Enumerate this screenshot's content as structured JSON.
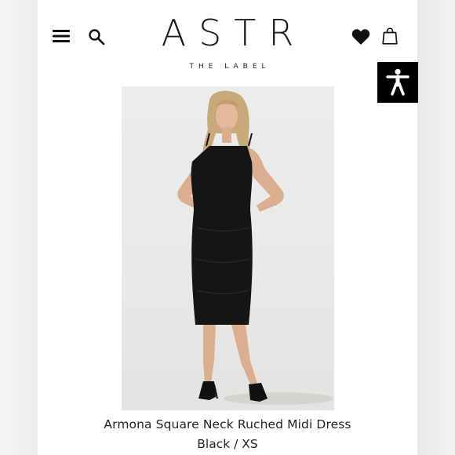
{
  "header": {
    "logo_main": "ASTR",
    "logo_sub": "THE LABEL",
    "icons": {
      "menu": "hamburger-menu-icon",
      "search": "search-icon",
      "wishlist": "heart-icon",
      "bag": "shopping-bag-icon",
      "accessibility": "accessibility-icon"
    }
  },
  "product": {
    "name": "Armona Square Neck Ruched Midi Dress",
    "variant": "Black / XS"
  },
  "colors": {
    "accessibility_bg": "#000000",
    "text": "#222222"
  }
}
